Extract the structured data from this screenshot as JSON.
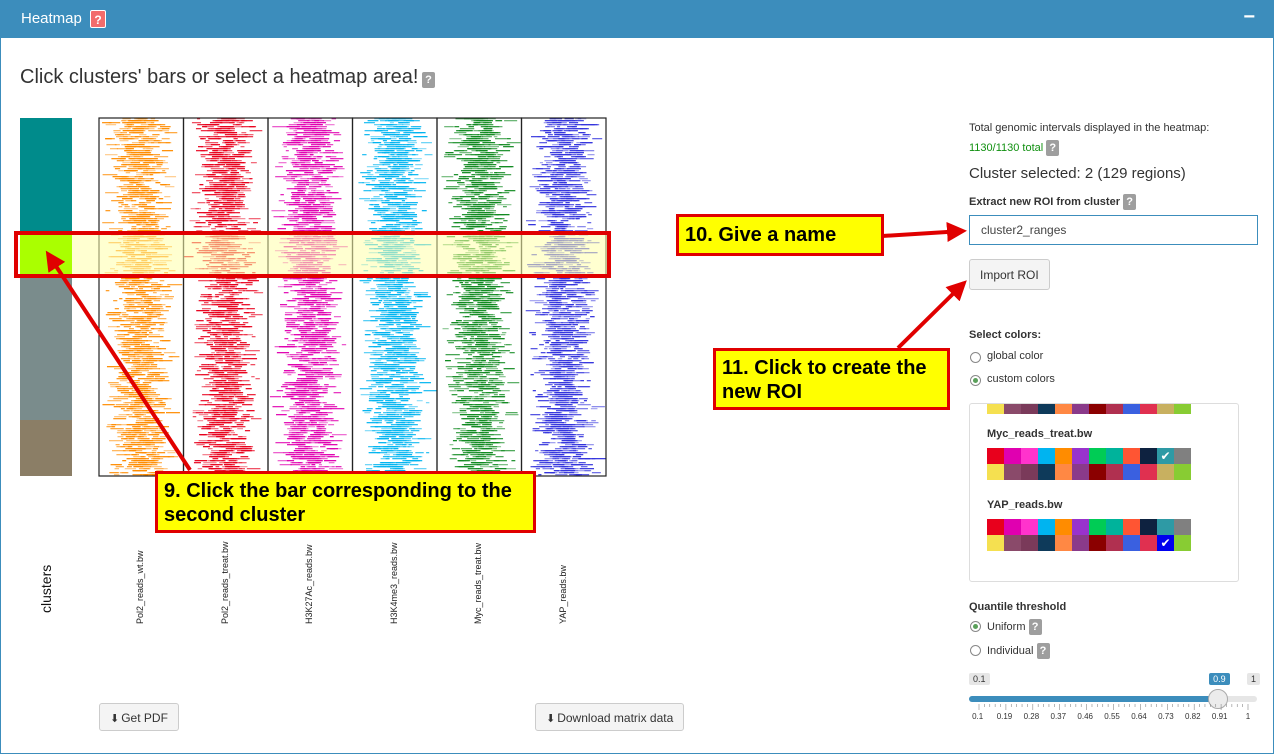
{
  "panel": {
    "title": "Heatmap",
    "help": "?",
    "collapse": "−"
  },
  "main_title": "Click clusters' bars or select a heatmap area!",
  "help_q": "?",
  "heatmap": {
    "clusters_label": "clusters",
    "samples": [
      {
        "name": "Pol2_reads_wt.bw",
        "color": "#ff8c00"
      },
      {
        "name": "Pol2_reads_treat.bw",
        "color": "#e8001c"
      },
      {
        "name": "H3K27Ac_reads.bw",
        "color": "#e000b0"
      },
      {
        "name": "H3K4me3_reads.bw",
        "color": "#00b4f0"
      },
      {
        "name": "Myc_reads_treat.bw",
        "color": "#108a20"
      },
      {
        "name": "YAP_reads.bw",
        "color": "#3333dd"
      }
    ],
    "cluster_colors": [
      "#008b8b",
      "#aaff00",
      "#7a8c8c",
      "#8b7e66"
    ],
    "selection_fill": "#ffffaa"
  },
  "buttons": {
    "get_pdf": "Get PDF",
    "download_matrix": "Download matrix data",
    "import_roi": "Import ROI"
  },
  "sidebar": {
    "total_label": "Total genomic intervals displayed in the heatmap:",
    "total_value": "1130/1130 total",
    "cluster_selected": "Cluster selected: 2 (129 regions)",
    "extract_label": "Extract new ROI from cluster",
    "roi_name_value": "cluster2_ranges",
    "select_colors_label": "Select colors:",
    "radio_global": "global color",
    "radio_custom": "custom colors",
    "palette_rows": [
      [
        "#e8001c",
        "#e000b0",
        "#ff33cc",
        "#00b4f0",
        "#ff8c00",
        "#9933cc",
        "#00cc55",
        "#00b39b",
        "#ff5533",
        "#0e2240",
        "#2e9aa5",
        "#808080"
      ],
      [
        "#f5e050",
        "#8a4a6a",
        "#7a3a5a",
        "#0e3a5a",
        "#ff8844",
        "#8a3a8a",
        "#8b0000",
        "#b03050",
        "#3a60e0",
        "#e03050",
        "#c8b060",
        "#88cc33"
      ]
    ],
    "tracks": [
      {
        "name": "Myc_reads_treat.bw",
        "checked_row": 0,
        "checked_col": 10
      },
      {
        "name": "YAP_reads.bw",
        "checked_row": 1,
        "checked_col": 10
      }
    ],
    "quantile_label": "Quantile threshold",
    "radio_uniform": "Uniform",
    "radio_individual": "Individual",
    "slider": {
      "min": 0.1,
      "max": 1,
      "value": 0.9,
      "ticks": [
        "0.1",
        "0.19",
        "0.28",
        "0.37",
        "0.46",
        "0.55",
        "0.64",
        "0.73",
        "0.82",
        "0.91",
        "1"
      ],
      "min_label": "0.1",
      "max_label": "1",
      "value_label": "0.9"
    }
  },
  "annotations": {
    "step9": "9. Click the bar corresponding to the second cluster",
    "step10": "10. Give a name",
    "step11": "11. Click to create the new ROI"
  },
  "colors": {
    "accent": "#3c8dbc",
    "annotation_fill": "#ffff00",
    "annotation_border": "#e00000"
  }
}
